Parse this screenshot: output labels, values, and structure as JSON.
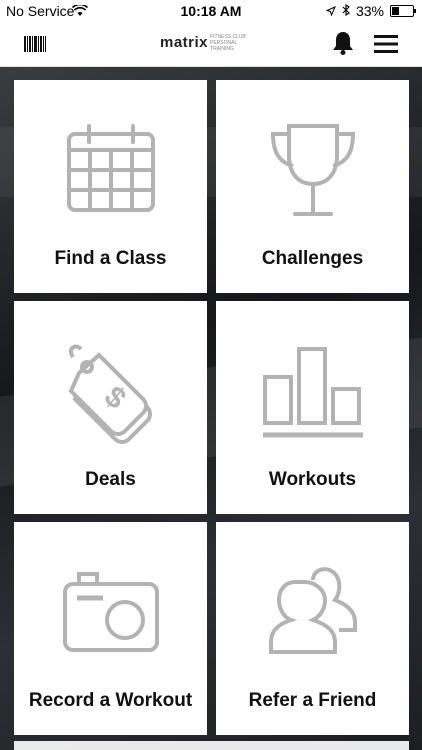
{
  "status_bar": {
    "carrier": "No Service",
    "time": "10:18 AM",
    "battery_percent": "33%",
    "battery_level": 0.33
  },
  "nav": {
    "logo_word": "matrix",
    "logo_sub": "FITNESS CLUB PERSONAL TRAINING"
  },
  "tiles": [
    {
      "label": "Find a Class",
      "icon": "calendar-icon"
    },
    {
      "label": "Challenges",
      "icon": "trophy-icon"
    },
    {
      "label": "Deals",
      "icon": "price-tag-icon"
    },
    {
      "label": "Workouts",
      "icon": "bar-chart-icon"
    },
    {
      "label": "Record a Workout",
      "icon": "camera-icon"
    },
    {
      "label": "Refer a Friend",
      "icon": "users-icon"
    }
  ],
  "colors": {
    "icon_gray": "#b3b3b3",
    "tile_bg": "#ffffff",
    "text": "#111111"
  }
}
